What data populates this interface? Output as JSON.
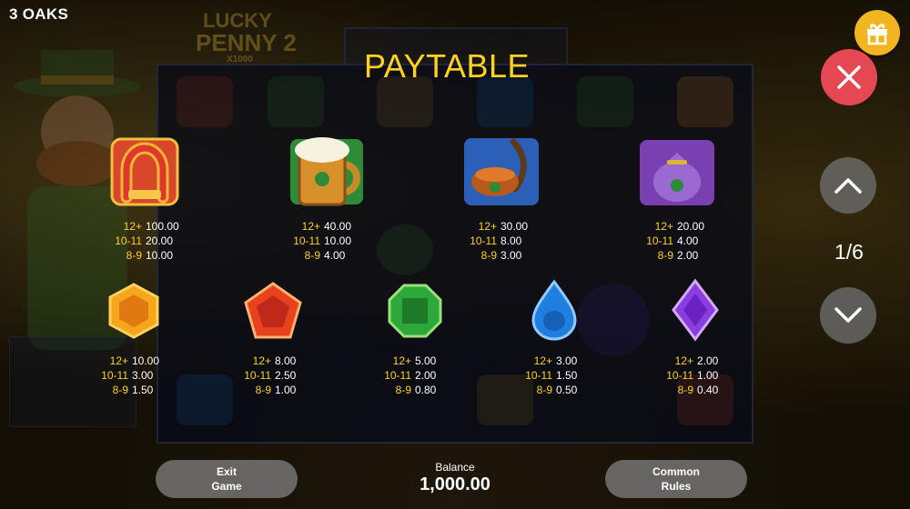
{
  "header": {
    "game_name": "3 OAKS",
    "title": "PAYTABLE",
    "logo_lines": [
      "LUCKY",
      "PENNY 2",
      "X1000"
    ]
  },
  "controls": {
    "gift_icon": "gift-icon",
    "close_icon": "close-icon",
    "up_icon": "chevron-up-icon",
    "down_icon": "chevron-down-icon",
    "page_indicator": "1/6"
  },
  "symbols": [
    {
      "name": "horseshoe",
      "payouts": [
        {
          "count": "12+",
          "value": "100.00"
        },
        {
          "count": "10-11",
          "value": "20.00"
        },
        {
          "count": "8-9",
          "value": "10.00"
        }
      ]
    },
    {
      "name": "beer-mug",
      "payouts": [
        {
          "count": "12+",
          "value": "40.00"
        },
        {
          "count": "10-11",
          "value": "10.00"
        },
        {
          "count": "8-9",
          "value": "4.00"
        }
      ]
    },
    {
      "name": "pipe",
      "payouts": [
        {
          "count": "12+",
          "value": "30.00"
        },
        {
          "count": "10-11",
          "value": "8.00"
        },
        {
          "count": "8-9",
          "value": "3.00"
        }
      ]
    },
    {
      "name": "money-bag",
      "payouts": [
        {
          "count": "12+",
          "value": "20.00"
        },
        {
          "count": "10-11",
          "value": "4.00"
        },
        {
          "count": "8-9",
          "value": "2.00"
        }
      ]
    },
    {
      "name": "orange-hexagon-gem",
      "payouts": [
        {
          "count": "12+",
          "value": "10.00"
        },
        {
          "count": "10-11",
          "value": "3.00"
        },
        {
          "count": "8-9",
          "value": "1.50"
        }
      ]
    },
    {
      "name": "red-pentagon-gem",
      "payouts": [
        {
          "count": "12+",
          "value": "8.00"
        },
        {
          "count": "10-11",
          "value": "2.50"
        },
        {
          "count": "8-9",
          "value": "1.00"
        }
      ]
    },
    {
      "name": "green-octagon-gem",
      "payouts": [
        {
          "count": "12+",
          "value": "5.00"
        },
        {
          "count": "10-11",
          "value": "2.00"
        },
        {
          "count": "8-9",
          "value": "0.80"
        }
      ]
    },
    {
      "name": "blue-drop-gem",
      "payouts": [
        {
          "count": "12+",
          "value": "3.00"
        },
        {
          "count": "10-11",
          "value": "1.50"
        },
        {
          "count": "8-9",
          "value": "0.50"
        }
      ]
    },
    {
      "name": "purple-diamond-gem",
      "payouts": [
        {
          "count": "12+",
          "value": "2.00"
        },
        {
          "count": "10-11",
          "value": "1.00"
        },
        {
          "count": "8-9",
          "value": "0.40"
        }
      ]
    }
  ],
  "footer": {
    "exit_line1": "Exit",
    "exit_line2": "Game",
    "balance_label": "Balance",
    "balance_value": "1,000.00",
    "rules_line1": "Common",
    "rules_line2": "Rules"
  },
  "colors": {
    "accent_yellow": "#ffd21e",
    "close_red": "#e54852",
    "gift_gold": "#f2b51f"
  }
}
